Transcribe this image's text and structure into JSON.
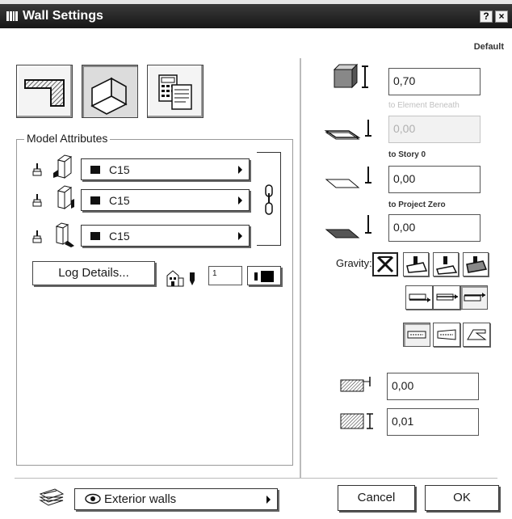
{
  "window": {
    "title": "Wall Settings",
    "help_label": "?",
    "close_label": "×",
    "subtitle": "Default"
  },
  "tabs": [
    {
      "name": "floor-plan-tab",
      "icon": "floor-plan-icon",
      "active": false
    },
    {
      "name": "model-tab",
      "icon": "wall-3d-icon",
      "active": true
    },
    {
      "name": "listing-tab",
      "icon": "calculator-document-icon",
      "active": false
    }
  ],
  "model_attributes": {
    "title": "Model Attributes",
    "rows": [
      {
        "icon": "wall-face-left-icon",
        "material": "C15"
      },
      {
        "icon": "wall-face-right-icon",
        "material": "C15"
      },
      {
        "icon": "wall-face-side-icon",
        "material": "C15"
      }
    ],
    "chain_icon": "chain-link-icon"
  },
  "log_details": {
    "label": "Log Details..."
  },
  "pen": {
    "icon": "building-icon",
    "pen_icon": "pen-icon",
    "value": "1"
  },
  "geometry": {
    "height": {
      "value": "0,70",
      "icon": "wall-height-icon"
    },
    "to_element_beneath": {
      "caption": "to Element Beneath",
      "value": "0,00",
      "disabled": true
    },
    "to_story": {
      "caption": "to Story 0",
      "value": "0,00"
    },
    "to_project_zero": {
      "caption": "to Project Zero",
      "value": "0,00"
    }
  },
  "gravity": {
    "label": "Gravity:",
    "selected": 0
  },
  "reference_line": {
    "selected": 2
  },
  "structure": {
    "selected": 0
  },
  "offsets": {
    "offset": {
      "value": "0,00",
      "icon": "wall-offset-icon"
    },
    "thickness": {
      "value": "0,01",
      "icon": "wall-thickness-icon"
    }
  },
  "layer": {
    "label": "Exterior walls",
    "icon": "layers-icon",
    "visibility_icon": "eye-icon"
  },
  "buttons": {
    "cancel": "Cancel",
    "ok": "OK"
  },
  "colors": {
    "titlebar": "#1a1a1a",
    "swatch": "#111111"
  }
}
